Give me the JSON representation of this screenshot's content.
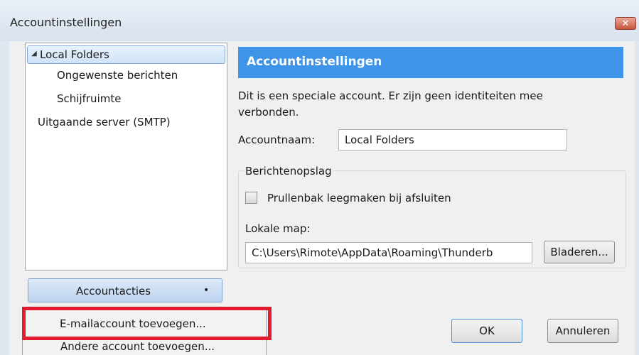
{
  "window": {
    "title": "Accountinstellingen",
    "close_label": "✕"
  },
  "sidebar": {
    "items": [
      {
        "label": "Local Folders",
        "expanded_indicator": "◢"
      },
      {
        "label": "Ongewenste berichten"
      },
      {
        "label": "Schijfruimte"
      },
      {
        "label": "Uitgaande server (SMTP)"
      }
    ],
    "actions_button": "Accountacties",
    "actions_dropdown_indicator": "•",
    "menu": [
      {
        "label": "E-mailaccount toevoegen..."
      },
      {
        "label": "Andere account toevoegen..."
      }
    ]
  },
  "panel": {
    "header": "Accountinstellingen",
    "description": "Dit is een speciale account. Er zijn geen identiteiten mee verbonden.",
    "account_name_label": "Accountnaam:",
    "account_name_value": "Local Folders",
    "storage_group": {
      "title": "Berichtenopslag",
      "empty_trash_label": "Prullenbak leegmaken bij afsluiten",
      "local_dir_label": "Lokale map:",
      "local_dir_value": "C:\\Users\\Rimote\\AppData\\Roaming\\Thunderb",
      "browse_button": "Bladeren..."
    }
  },
  "dialog_buttons": {
    "ok": "OK",
    "cancel": "Annuleren"
  },
  "colors": {
    "header_bg": "#3e95e8",
    "highlight_box": "#e21c2e",
    "selection": "#cfe3f8"
  }
}
